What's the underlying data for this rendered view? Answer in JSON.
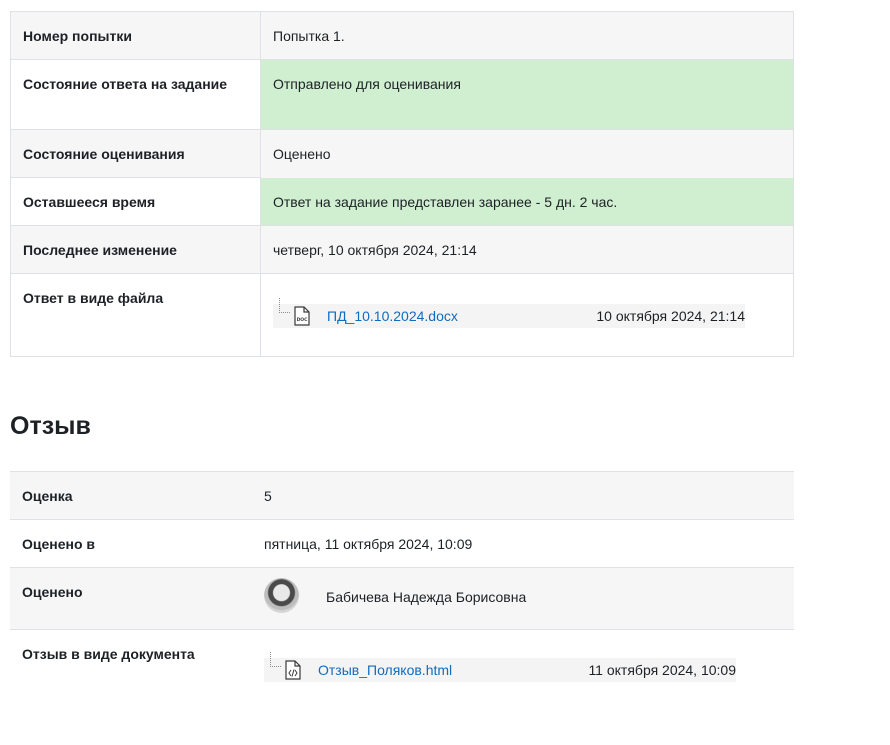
{
  "submission": {
    "rows": [
      {
        "label": "Номер попытки",
        "value": "Попытка 1."
      },
      {
        "label": "Состояние ответа на задание",
        "value": "Отправлено для оценивания"
      },
      {
        "label": "Состояние оценивания",
        "value": "Оценено"
      },
      {
        "label": "Оставшееся время",
        "value": "Ответ на задание представлен заранее - 5 дн. 2 час."
      },
      {
        "label": "Последнее изменение",
        "value": "четверг, 10 октября 2024, 21:14"
      }
    ],
    "file": {
      "label": "Ответ в виде файла",
      "icon": "docx-file-icon",
      "name": "ПД_10.10.2024.docx",
      "date": "10 октября 2024, 21:14"
    }
  },
  "feedback": {
    "heading": "Отзыв",
    "grade": {
      "label": "Оценка",
      "value": "5"
    },
    "graded_on": {
      "label": "Оценено в",
      "value": "пятница, 11 октября 2024, 10:09"
    },
    "graded_by": {
      "label": "Оценено",
      "name": "Бабичева Надежда Борисовна"
    },
    "document": {
      "label": "Отзыв в виде документа",
      "icon": "html-file-icon",
      "name": "Отзыв_Поляков.html",
      "date": "11 октября 2024, 10:09"
    }
  },
  "colors": {
    "success_bg": "#cfefd0",
    "link": "#0f6cbf",
    "shade_bg": "#f6f6f6",
    "border": "#dee2e6"
  }
}
